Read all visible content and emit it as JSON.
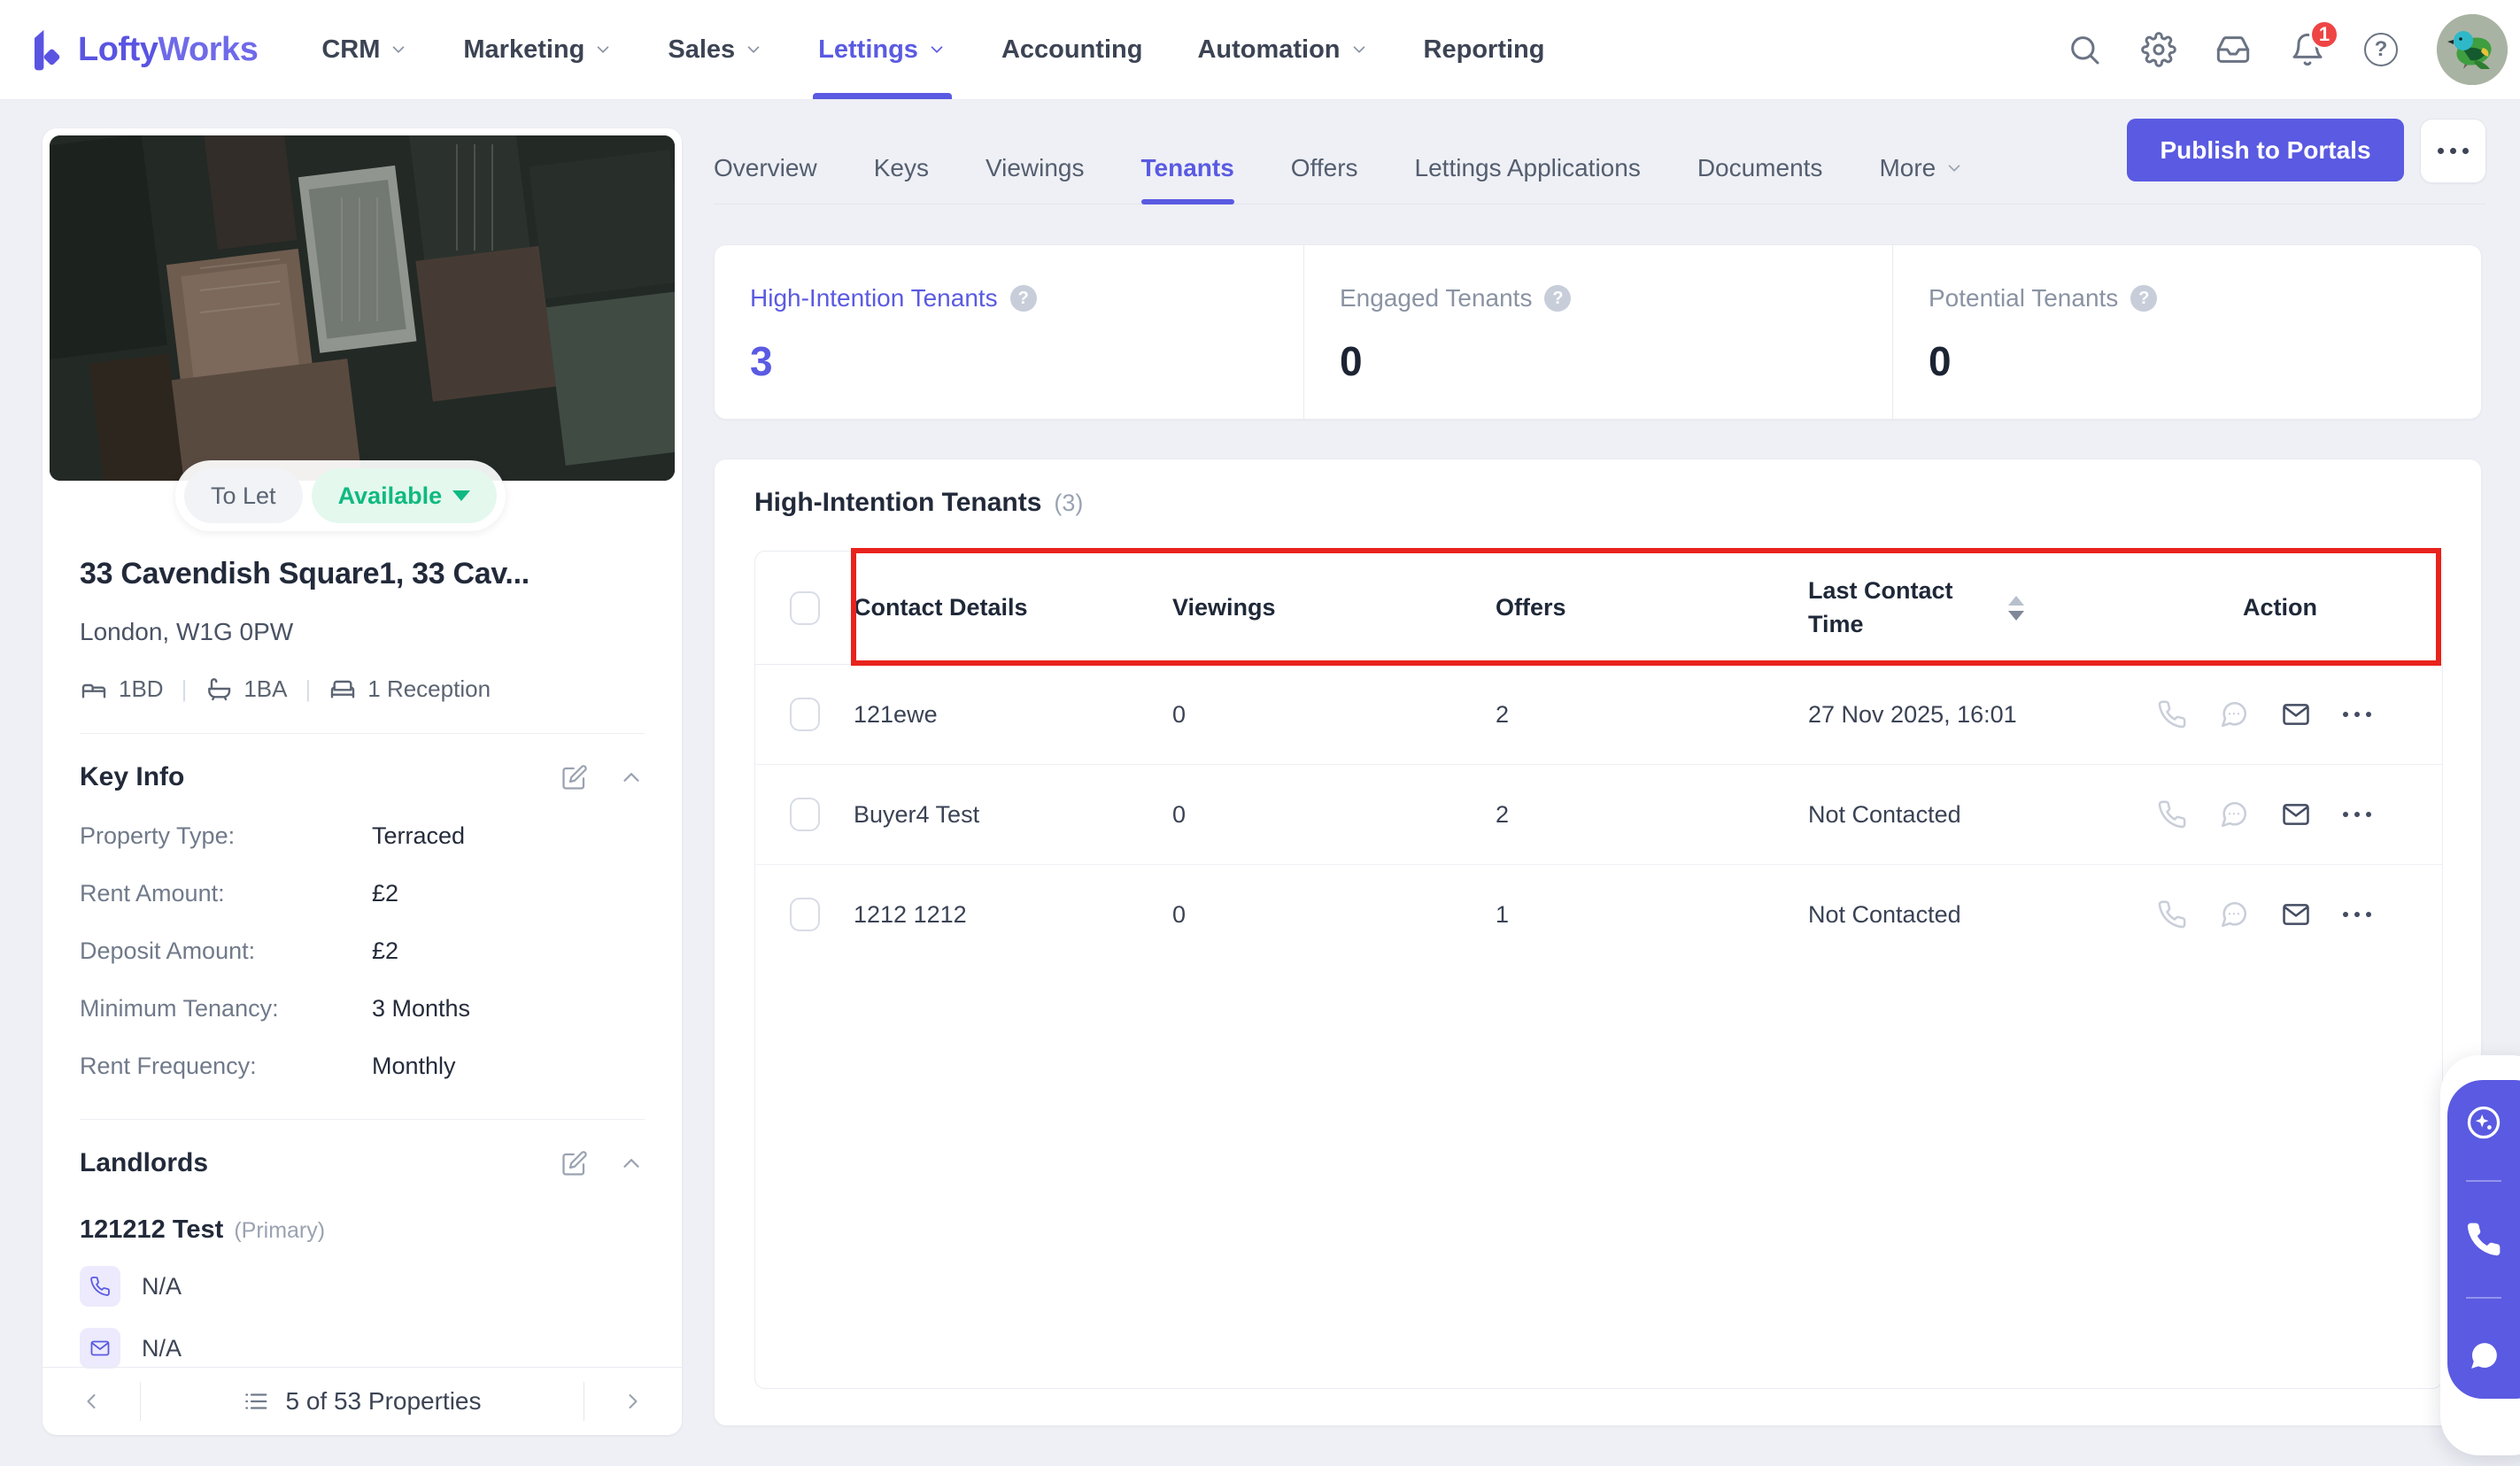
{
  "colors": {
    "accent": "#5a5ae2",
    "highlight_red": "#e8231d",
    "green": "#10b981",
    "notification_red": "#ef4444",
    "page_bg": "#eef0f5",
    "dark_text": "#222a3a",
    "gray_text": "#707a8a"
  },
  "nav": {
    "logo_part1": "Lofty",
    "logo_part2": "Works",
    "items": [
      {
        "label": "CRM",
        "has_menu": true
      },
      {
        "label": "Marketing",
        "has_menu": true
      },
      {
        "label": "Sales",
        "has_menu": true
      },
      {
        "label": "Lettings",
        "has_menu": true,
        "active": true
      },
      {
        "label": "Accounting",
        "has_menu": false
      },
      {
        "label": "Automation",
        "has_menu": true
      },
      {
        "label": "Reporting",
        "has_menu": false
      }
    ],
    "icons": [
      "search-icon",
      "gear-icon",
      "inbox-icon",
      "bell-icon",
      "help-icon",
      "avatar"
    ],
    "notification_count": "1"
  },
  "property": {
    "status_to_let": "To Let",
    "status_available": "Available",
    "title": "33 Cavendish Square1, 33 Cav...",
    "address": "London, W1G 0PW",
    "features": [
      {
        "icon": "bed-icon",
        "label": "1BD"
      },
      {
        "icon": "bath-icon",
        "label": "1BA"
      },
      {
        "icon": "sofa-icon",
        "label": "1 Reception"
      }
    ],
    "key_info": {
      "heading": "Key Info",
      "rows": [
        {
          "label": "Property Type:",
          "value": "Terraced"
        },
        {
          "label": "Rent Amount:",
          "value": "£2"
        },
        {
          "label": "Deposit Amount:",
          "value": "£2"
        },
        {
          "label": "Minimum Tenancy:",
          "value": "3 Months"
        },
        {
          "label": "Rent Frequency:",
          "value": "Monthly"
        }
      ]
    },
    "landlords": {
      "heading": "Landlords",
      "name": "121212 Test",
      "tag": "(Primary)",
      "phone": "N/A",
      "email": "N/A"
    },
    "pagination": {
      "label": "5 of 53 Properties"
    }
  },
  "toolbar": {
    "publish_label": "Publish to Portals"
  },
  "tabs": {
    "items": [
      {
        "label": "Overview"
      },
      {
        "label": "Keys"
      },
      {
        "label": "Viewings"
      },
      {
        "label": "Tenants",
        "active": true
      },
      {
        "label": "Offers"
      },
      {
        "label": "Lettings Applications"
      },
      {
        "label": "Documents"
      },
      {
        "label": "More",
        "has_menu": true
      }
    ]
  },
  "stats": {
    "cards": [
      {
        "label": "High-Intention Tenants",
        "value": "3",
        "accent": true
      },
      {
        "label": "Engaged Tenants",
        "value": "0",
        "accent": false
      },
      {
        "label": "Potential Tenants",
        "value": "0",
        "accent": false
      }
    ]
  },
  "table": {
    "title": "High-Intention Tenants",
    "count": "(3)",
    "columns": {
      "contact": "Contact Details",
      "viewings": "Viewings",
      "offers": "Offers",
      "last_contact": "Last Contact Time",
      "action": "Action"
    },
    "row_action_icons": [
      "phone-icon",
      "chat-icon",
      "mail-icon",
      "more-icon"
    ],
    "rows": [
      {
        "name": "121ewe",
        "viewings": "0",
        "offers": "2",
        "last_contact": "27 Nov 2025, 16:01"
      },
      {
        "name": "Buyer4 Test",
        "viewings": "0",
        "offers": "2",
        "last_contact": "Not Contacted"
      },
      {
        "name": "1212 1212",
        "viewings": "0",
        "offers": "1",
        "last_contact": "Not Contacted"
      }
    ]
  },
  "widget": {
    "icons": [
      "sparkle-icon",
      "phone-icon",
      "chat-icon"
    ]
  }
}
